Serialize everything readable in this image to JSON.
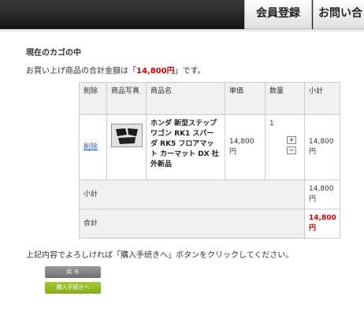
{
  "nav": {
    "register": "会員登録",
    "contact": "お問い合"
  },
  "page": {
    "heading": "現在のカゴの中",
    "total_prefix": "お買い上げ商品の合計金額は「",
    "total_amount": "14,800円",
    "total_suffix": "」です。",
    "instruction": "上記内容でよろしければ「購入手続きへ」ボタンをクリックしてください。"
  },
  "table": {
    "headers": [
      "削除",
      "商品写真",
      "商品名",
      "単価",
      "数量",
      "小計"
    ],
    "item": {
      "delete_label": "削除",
      "image_icon": "product-thumbnail",
      "name": "ホンダ 新型ステップワゴン RK1 スパーダ RK5 フロアマット カーマット DX 社外新品",
      "unit_price": "14,800円",
      "quantity": "1",
      "increment": "+",
      "decrement": "−",
      "subtotal": "14,800円"
    },
    "subtotal_label": "小計",
    "subtotal_value": "14,800円",
    "total_label": "合計",
    "total_value": "14,800円"
  },
  "buttons": {
    "back": "戻 る",
    "checkout": "購入手続きへ"
  },
  "colors": {
    "accent_red": "#d00000",
    "checkout_green": "#94bb24",
    "back_gray": "#808080",
    "link_blue": "#2a5db0"
  }
}
